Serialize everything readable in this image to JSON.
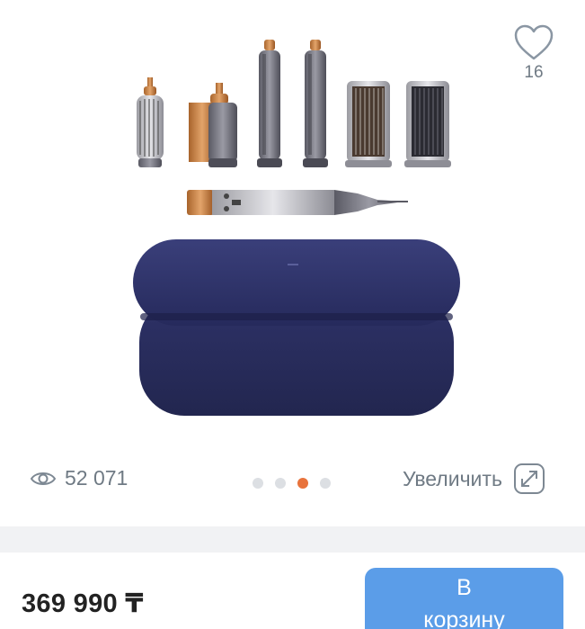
{
  "favorite": {
    "icon": "heart-icon",
    "count": "16"
  },
  "gallery": {
    "image_alt": "Dyson Airwrap с насадками и кейсом",
    "views": {
      "icon": "eye-icon",
      "count": "52 071"
    },
    "slides": {
      "total": 4,
      "active_index": 2
    },
    "zoom": {
      "label": "Увеличить",
      "icon": "expand-icon"
    }
  },
  "purchase": {
    "price": "369 990 ₸",
    "cart_button": {
      "line1": "В",
      "line2": "корзину"
    }
  },
  "colors": {
    "accent": "#e8733c",
    "button": "#5b9de8",
    "muted_text": "#6f7a84",
    "case": "#2b2f62"
  }
}
